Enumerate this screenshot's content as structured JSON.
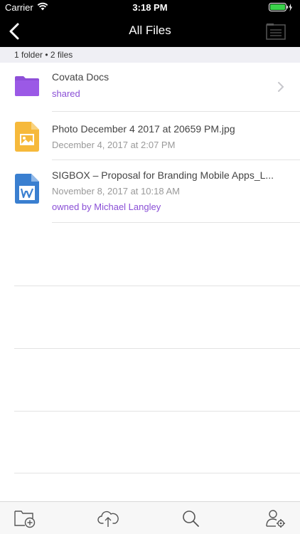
{
  "status_bar": {
    "carrier": "Carrier",
    "time": "3:18 PM",
    "icons": [
      "wifi-icon",
      "battery-icon",
      "charging-icon"
    ]
  },
  "nav": {
    "title": "All Files",
    "back_icon": "chevron-left-icon",
    "right_icon": "document-icon"
  },
  "summary": "1 folder • 2 files",
  "items": [
    {
      "type": "folder",
      "name": "Covata Docs",
      "subtitle": "shared",
      "icon": "folder-icon",
      "accessory": "chevron-right-icon"
    },
    {
      "type": "image",
      "name": "Photo December 4 2017 at 20659 PM.jpg",
      "date": "December 4, 2017 at 2:07 PM",
      "icon": "image-file-icon"
    },
    {
      "type": "word",
      "name": "SIGBOX – Proposal for Branding Mobile Apps_L...",
      "date": "November 8, 2017 at 10:18 AM",
      "owner": "owned by Michael Langley",
      "icon": "word-file-icon"
    }
  ],
  "tabs": [
    "new-folder-icon",
    "cloud-upload-icon",
    "search-icon",
    "user-settings-icon"
  ],
  "colors": {
    "accent": "#8a4fd6",
    "folder": "#8e4fd8",
    "image_file": "#f6b93b",
    "word_file": "#3a7fd0",
    "nav_bg": "#000000"
  }
}
